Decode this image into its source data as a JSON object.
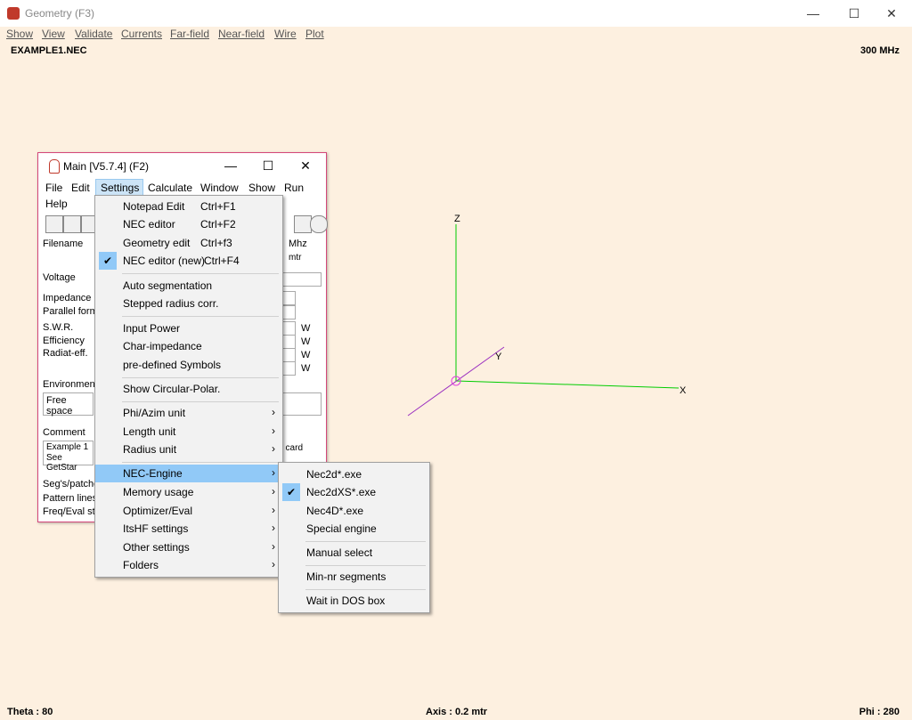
{
  "window": {
    "title": "Geometry  (F3)",
    "minimize": "—",
    "maximize": "☐",
    "close": "✕"
  },
  "menubar": [
    "Show",
    "View",
    "Validate",
    "Currents",
    "Far-field",
    "Near-field",
    "Wire",
    "Plot"
  ],
  "file_name": "EXAMPLE1.NEC",
  "frequency": "300 MHz",
  "status": {
    "theta": "Theta : 80",
    "axis": "Axis : 0.2 mtr",
    "phi": "Phi : 280"
  },
  "axes": {
    "z": "Z",
    "y": "Y",
    "x": "X",
    "x_color": "#00cc00",
    "z_color": "#00cc00",
    "y_color": "#9b30c0"
  },
  "main_window": {
    "title": "Main [V5.7.4]  (F2)",
    "menu": [
      "File",
      "Edit",
      "Settings",
      "Calculate",
      "Window",
      "Show",
      "Run",
      "Help"
    ],
    "labels": {
      "filename": "Filename",
      "voltage": "Voltage",
      "impedance": "Impedance",
      "parallel_form": "Parallel form",
      "swr": "S.W.R.",
      "efficiency": "Efficiency",
      "radiat_eff": "Radiat-eff.",
      "environment": "Environment",
      "comment": "Comment",
      "segs": "Seg's/patche",
      "pattern_lines": "Pattern lines",
      "freq_eval": "Freq/Eval ste",
      "mhz": "Mhz",
      "mtr": "mtr",
      "w": "W"
    },
    "environment_value": "Free space",
    "comment_lines": [
      "Example 1 :",
      "See GetStar"
    ],
    "comment_right": "t card"
  },
  "settings_menu": {
    "items": [
      {
        "label": "Notepad Edit",
        "shortcut": "Ctrl+F1"
      },
      {
        "label": "NEC editor",
        "shortcut": "Ctrl+F2"
      },
      {
        "label": "Geometry edit",
        "shortcut": "Ctrl+f3"
      },
      {
        "label": "NEC editor (new)",
        "shortcut": "Ctrl+F4"
      },
      {
        "label": "Auto segmentation"
      },
      {
        "label": "Stepped radius corr."
      },
      {
        "label": "Input Power"
      },
      {
        "label": "Char-impedance"
      },
      {
        "label": "pre-defined Symbols"
      },
      {
        "label": "Show Circular-Polar."
      },
      {
        "label": "Phi/Azim unit"
      },
      {
        "label": "Length unit"
      },
      {
        "label": "Radius unit"
      },
      {
        "label": "NEC-Engine"
      },
      {
        "label": "Memory usage"
      },
      {
        "label": "Optimizer/Eval"
      },
      {
        "label": "ItsHF settings"
      },
      {
        "label": "Other settings"
      },
      {
        "label": "Folders"
      }
    ]
  },
  "engine_menu": {
    "items": [
      {
        "label": "Nec2d*.exe"
      },
      {
        "label": "Nec2dXS*.exe"
      },
      {
        "label": "Nec4D*.exe"
      },
      {
        "label": "Special engine"
      },
      {
        "label": "Manual select"
      },
      {
        "label": "Min-nr segments"
      },
      {
        "label": "Wait in DOS box"
      }
    ]
  },
  "icons": {
    "check": "✔",
    "submenu_arrow": "›"
  }
}
